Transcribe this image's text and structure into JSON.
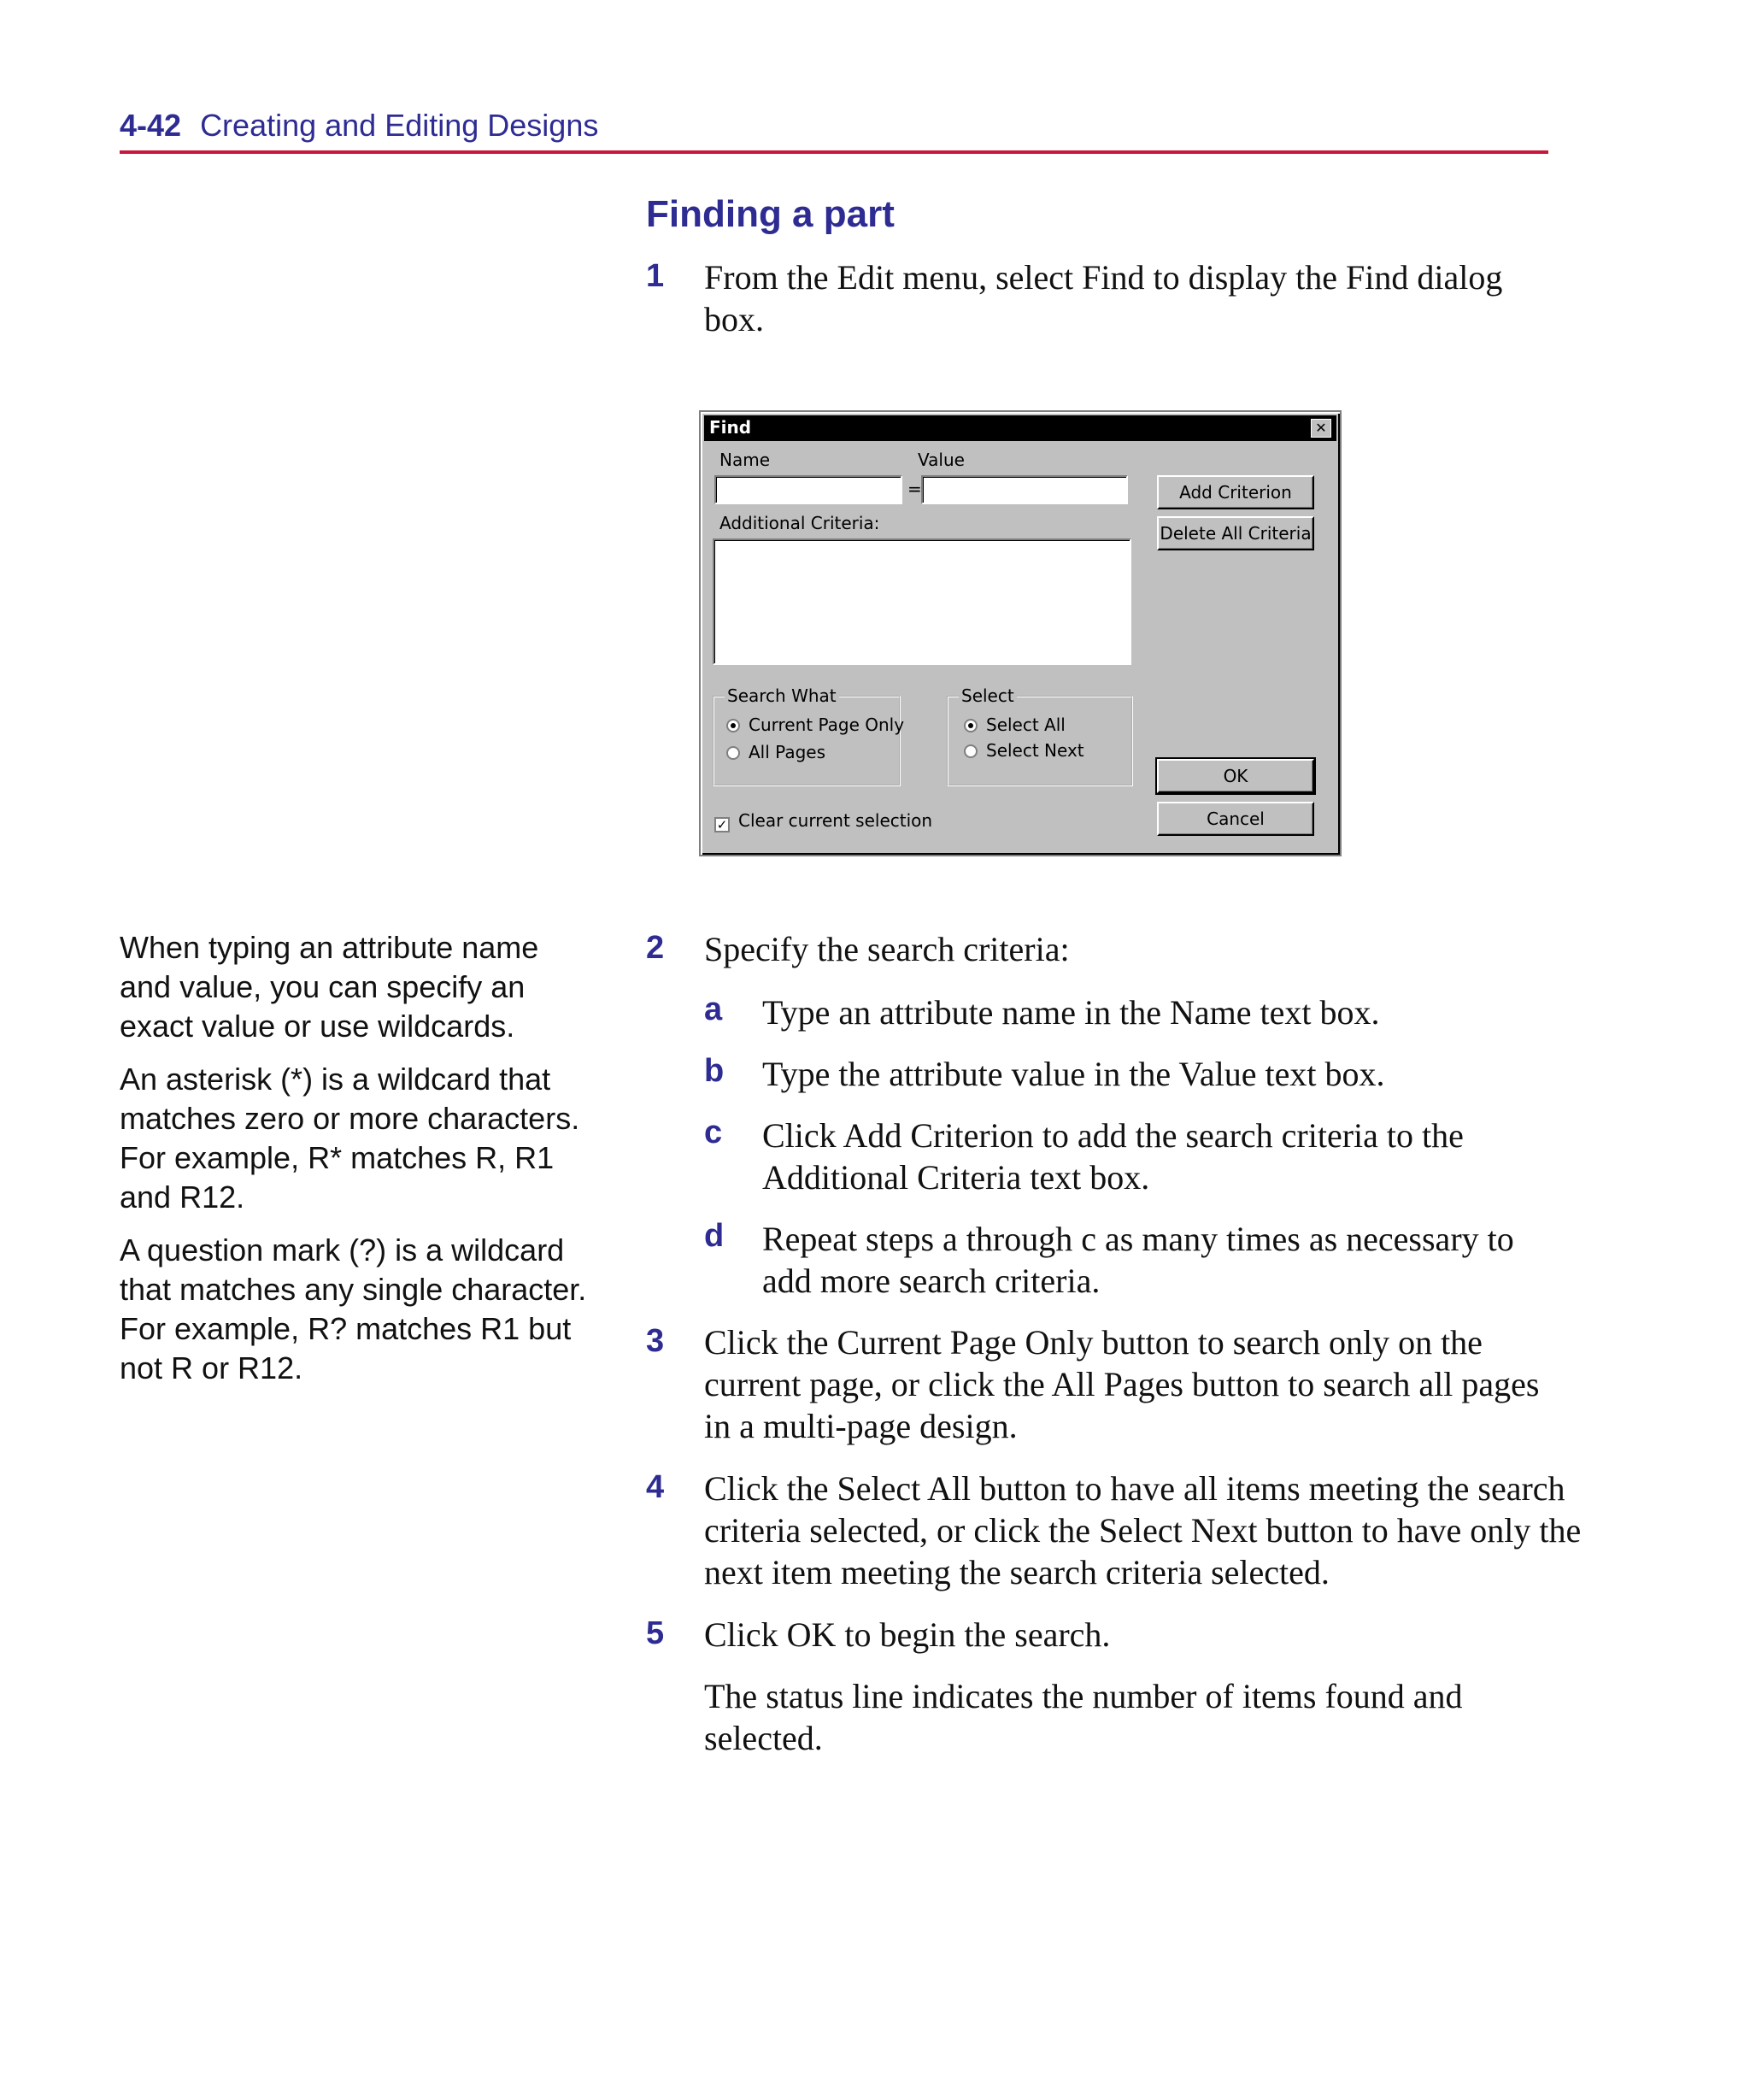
{
  "header": {
    "page_number": "4-42",
    "chapter_title": "Creating and Editing Designs"
  },
  "section_title": "Finding a part",
  "steps": [
    {
      "number": "1",
      "text": "From the Edit menu, select Find to display the Find dialog box."
    },
    {
      "number": "2",
      "text": "Specify the search criteria:"
    },
    {
      "number": "3",
      "text": "Click the Current Page Only button to search only on the current page, or click the All Pages button to search all pages in a multi-page design."
    },
    {
      "number": "4",
      "text": "Click the Select All button to have all items meeting the search criteria selected, or click the Select Next button to have only the next item meeting the search criteria selected."
    },
    {
      "number": "5",
      "text": "Click OK to begin the search."
    }
  ],
  "substeps": [
    {
      "letter": "a",
      "text": "Type an attribute name in the Name text box."
    },
    {
      "letter": "b",
      "text": "Type the attribute value in the Value text box."
    },
    {
      "letter": "c",
      "text": "Click Add Criterion to add the search criteria to the Additional Criteria text box."
    },
    {
      "letter": "d",
      "text": "Repeat steps a through c as many times as necessary to add more search criteria."
    }
  ],
  "result_text": "The status line indicates the number of items found and selected.",
  "sidebar": [
    "When typing an attribute name and value, you can specify an exact value or use wildcards.",
    "An asterisk (*) is a wildcard that matches zero or more characters. For example, R* matches R, R1 and R12.",
    "A question mark (?) is a wildcard that matches any single character. For example, R? matches R1 but not R or R12."
  ],
  "dialog": {
    "title": "Find",
    "close_glyph": "✕",
    "name_label": "Name",
    "value_label": "Value",
    "equals": "=",
    "name_value": "",
    "value_value": "",
    "additional_label": "Additional Criteria:",
    "additional_value": "",
    "add_button": "Add Criterion",
    "delete_button": "Delete All Criteria",
    "search_what_label": "Search What",
    "radio_current": "Current Page Only",
    "radio_all": "All Pages",
    "select_label": "Select",
    "radio_select_all": "Select All",
    "radio_select_next": "Select Next",
    "ok_button": "OK",
    "cancel_button": "Cancel",
    "clear_label": "Clear current selection",
    "check_glyph": "✓"
  }
}
